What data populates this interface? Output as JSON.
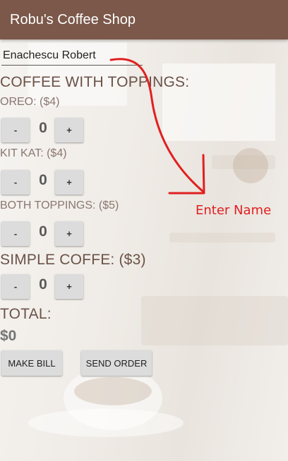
{
  "app": {
    "title": "Robu's Coffee Shop"
  },
  "name_field": {
    "value": "Enachescu Robert"
  },
  "sections": {
    "coffee_with_toppings": "COFFEE WITH TOPPINGS:",
    "oreo": "OREO: ($4)",
    "kitkat": "KIT KAT: ($4)",
    "both": "BOTH TOPPINGS: ($5)",
    "simple": "SIMPLE COFFE: ($3)",
    "total_label": "TOTAL:"
  },
  "steppers": {
    "minus_label": "-",
    "plus_label": "+",
    "oreo_qty": "0",
    "kitkat_qty": "0",
    "both_qty": "0",
    "simple_qty": "0"
  },
  "total": {
    "value": "$0"
  },
  "actions": {
    "make_bill": "MAKE BILL",
    "send_order": "SEND ORDER"
  },
  "annotation": {
    "text": "Enter Name",
    "color": "#e02020"
  },
  "colors": {
    "appbar": "#7b5849",
    "label": "#6b5248",
    "button": "#dcdcdc"
  }
}
